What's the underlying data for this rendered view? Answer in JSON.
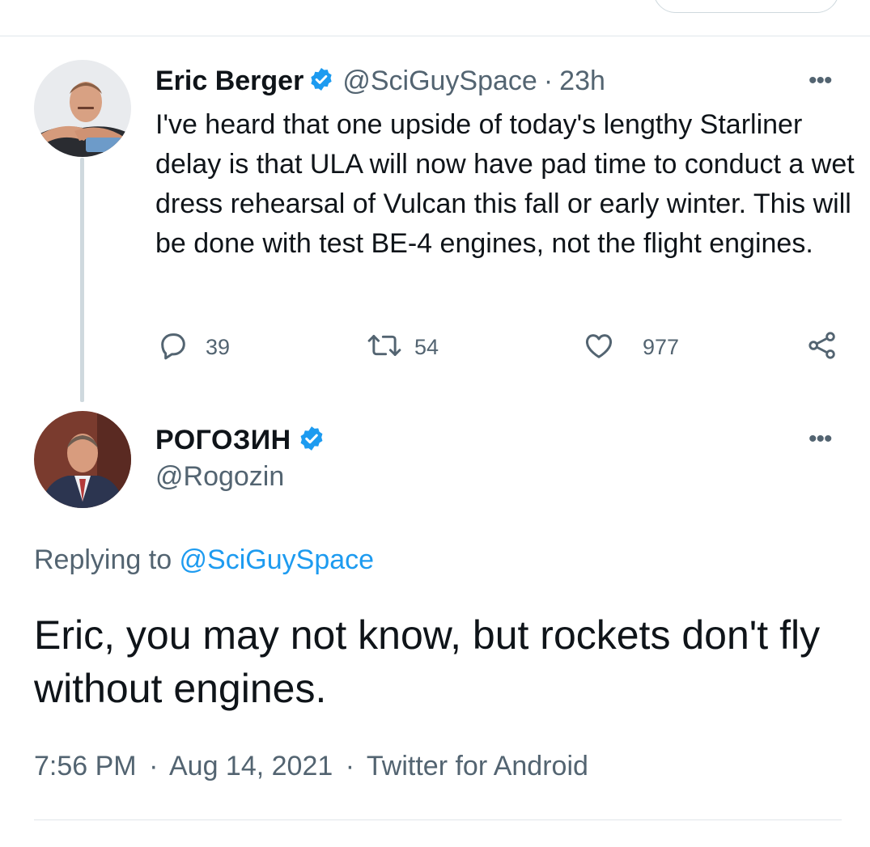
{
  "tweet1": {
    "name": "Eric Berger",
    "handle": "@SciGuySpace",
    "separator": "·",
    "time": "23h",
    "text": "I've heard that one upside of today's lengthy Starliner delay is that ULA will now have pad time to conduct a wet dress rehearsal of Vulcan this fall or early winter. This will be done with test BE-4 engines, not the flight engines.",
    "more_label": "•••",
    "actions": {
      "replies": "39",
      "retweets": "54",
      "likes": "977"
    },
    "icons": [
      "reply-icon",
      "retweet-icon",
      "like-icon",
      "share-icon"
    ]
  },
  "tweet2": {
    "name": "РОГОЗИН",
    "handle": "@Rogozin",
    "more_label": "•••",
    "replying_prefix": "Replying to ",
    "replying_handle": "@SciGuySpace",
    "text": "Eric, you may not know, but rockets don't fly without engines.",
    "time": "7:56 PM",
    "separator": "·",
    "date": "Aug 14, 2021",
    "source": "Twitter for Android"
  },
  "colors": {
    "text": "#0f1419",
    "secondary": "#536471",
    "link": "#1d9bf0",
    "verified": "#1d9bf0",
    "divider": "#e1e6ea"
  }
}
